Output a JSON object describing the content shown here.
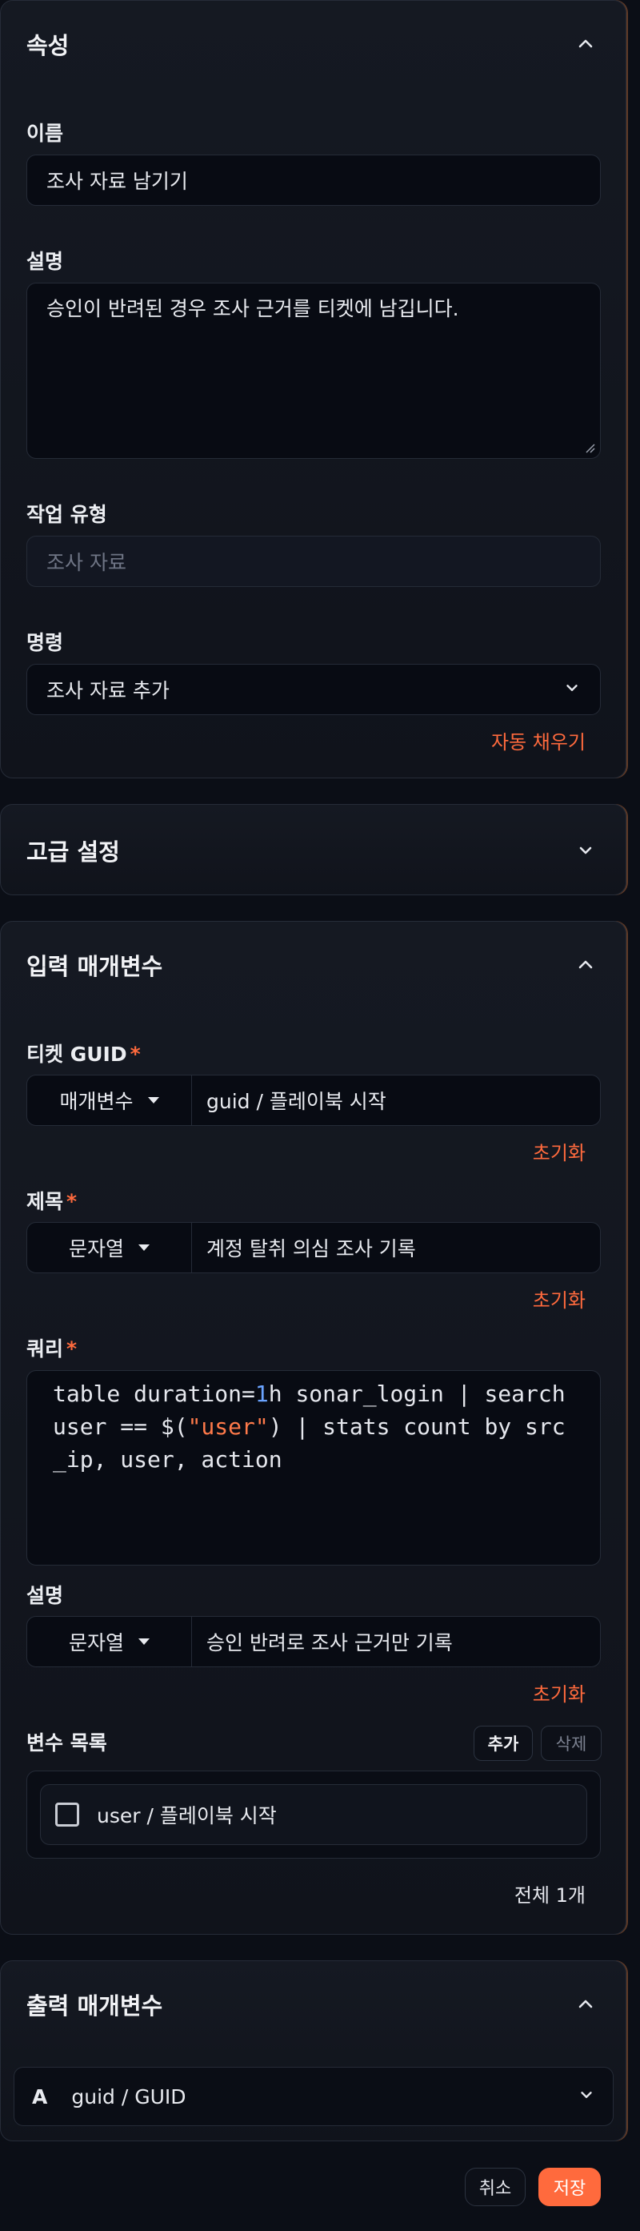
{
  "properties": {
    "title": "속성",
    "name_label": "이름",
    "name_value": "조사 자료 남기기",
    "description_label": "설명",
    "description_value": "승인이 반려된 경우 조사 근거를 티켓에 남깁니다.",
    "task_type_label": "작업 유형",
    "task_type_placeholder": "조사 자료",
    "command_label": "명령",
    "command_value": "조사 자료 추가",
    "autofill_link": "자동 채우기"
  },
  "advanced": {
    "title": "고급 설정"
  },
  "input_params": {
    "title": "입력 매개변수",
    "ticket_guid": {
      "label": "티켓 GUID",
      "required_mark": "*",
      "type": "매개변수",
      "value": "guid / 플레이북 시작",
      "reset": "초기화"
    },
    "subject": {
      "label": "제목",
      "required_mark": "*",
      "type": "문자열",
      "value": "계정 탈취 의심 조사 기록",
      "reset": "초기화"
    },
    "query": {
      "label": "쿼리",
      "required_mark": "*",
      "part1": "table duration=",
      "num": "1",
      "part2": "h sonar_login | search user == $(",
      "str": "\"user\"",
      "part3": ") | stats count by src_ip, user, action"
    },
    "description": {
      "label": "설명",
      "type": "문자열",
      "value": "승인 반려로 조사 근거만 기록",
      "reset": "초기화"
    },
    "variables": {
      "label": "변수 목록",
      "add_button": "추가",
      "delete_button": "삭제",
      "items": [
        {
          "text": "user / 플레이북 시작",
          "checked": false
        }
      ],
      "total": "전체 1개"
    }
  },
  "output_params": {
    "title": "출력 매개변수",
    "items": [
      {
        "type_icon": "A",
        "text": "guid / GUID"
      }
    ]
  },
  "footer": {
    "cancel": "취소",
    "save": "저장"
  },
  "colors": {
    "accent": "#ff6a3d",
    "background": "#0b0e16",
    "panel": "#151922",
    "code_number": "#6aa3ff",
    "code_string": "#ff7a4a"
  }
}
